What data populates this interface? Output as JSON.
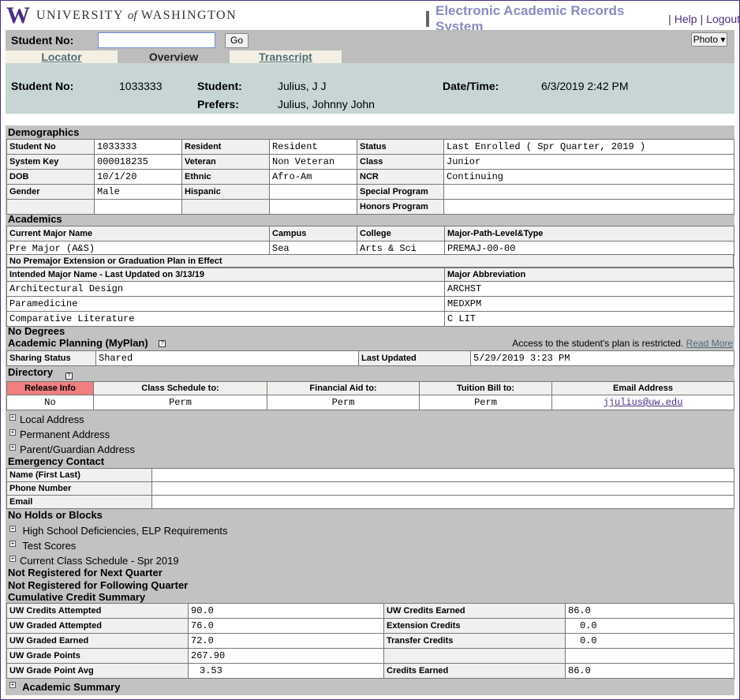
{
  "header": {
    "logo_letter": "W",
    "university_pre": "UNIVERSITY",
    "university_of": "of",
    "university_post": "WASHINGTON",
    "app_title": "Electronic Academic Records System",
    "help": "Help",
    "logout": "Logout",
    "sep": "|"
  },
  "search": {
    "label": "Student No:",
    "value": "",
    "go": "Go",
    "photo": "Photo ▾"
  },
  "tabs": [
    "Locator",
    "Overview",
    "Transcript"
  ],
  "student": {
    "no_label": "Student No:",
    "no": "1033333",
    "student_label": "Student:",
    "name": "Julius, J J",
    "prefers_label": "Prefers:",
    "prefers": "Julius, Johnny John",
    "datetime_label": "Date/Time:",
    "datetime": "6/3/2019 2:42 PM"
  },
  "demographics": {
    "title": "Demographics",
    "rows": [
      [
        "Student No",
        "1033333",
        "Resident",
        "Resident",
        "Status",
        "Last Enrolled ( Spr Quarter, 2019 )"
      ],
      [
        "System Key",
        "000018235",
        "Veteran",
        "Non Veteran",
        "Class",
        "Junior"
      ],
      [
        "DOB",
        "10/1/20",
        "Ethnic",
        "Afro-Am",
        "NCR",
        "Continuing"
      ],
      [
        "Gender",
        "Male",
        "Hispanic",
        "",
        "Special Program",
        ""
      ],
      [
        "",
        "",
        "",
        "",
        "Honors Program",
        ""
      ]
    ]
  },
  "academics": {
    "title": "Academics",
    "headers": [
      "Current Major Name",
      "Campus",
      "College",
      "Major-Path-Level&Type"
    ],
    "row": [
      "Pre Major (A&S)",
      "Sea",
      "Arts & Sci",
      "PREMAJ-00-00"
    ],
    "note": "No Premajor Extension or Graduation Plan in Effect",
    "intended_headers": [
      "Intended Major Name - Last Updated on 3/13/19",
      "Major Abbreviation"
    ],
    "intended_rows": [
      [
        "Architectural Design",
        "ARCHST"
      ],
      [
        "Paramedicine",
        "MEDXPM"
      ],
      [
        "Comparative Literature",
        "C LIT"
      ]
    ]
  },
  "no_degrees": "No Degrees",
  "planning": {
    "title": "Academic Planning (MyPlan)",
    "help_icon": "?",
    "restricted": "Access to the student's plan is restricted.",
    "read_more": "Read More",
    "sharing_label": "Sharing Status",
    "sharing_value": "Shared",
    "updated_label": "Last Updated",
    "updated_value": "5/29/2019 3:23 PM"
  },
  "directory": {
    "title": "Directory",
    "help_icon": "?",
    "headers": [
      "Release Info",
      "Class Schedule to:",
      "Financial Aid to:",
      "Tuition Bill to:",
      "Email Address"
    ],
    "row": [
      "No",
      "Perm",
      "Perm",
      "Perm",
      "jjulius@uw.edu"
    ],
    "addresses": [
      "Local Address",
      "Permanent Address",
      "Parent/Guardian Address"
    ]
  },
  "emergency": {
    "title": "Emergency Contact",
    "labels": [
      "Name (First Last)",
      "Phone Number",
      "Email"
    ]
  },
  "status_lines": {
    "holds": "No Holds or Blocks",
    "hs": "High School Deficiencies, ELP Requirements",
    "tests": "Test Scores",
    "schedule": "Current Class Schedule - Spr 2019",
    "next": "Not Registered for Next Quarter",
    "following": "Not Registered for Following Quarter",
    "credit_title": "Cumulative Credit Summary"
  },
  "credits": {
    "rows": [
      [
        "UW Credits Attempted",
        "90.0",
        "UW Credits Earned",
        "86.0"
      ],
      [
        "UW Graded Attempted",
        "76.0",
        "Extension Credits",
        "0.0"
      ],
      [
        "UW Graded Earned",
        "72.0",
        "Transfer Credits",
        "0.0"
      ],
      [
        "UW Grade Points",
        "267.90",
        "",
        ""
      ],
      [
        "UW Grade Point Avg",
        "3.53",
        "Credits Earned",
        "86.0"
      ]
    ]
  },
  "academic_summary": "Academic Summary",
  "plus_icon": "+"
}
